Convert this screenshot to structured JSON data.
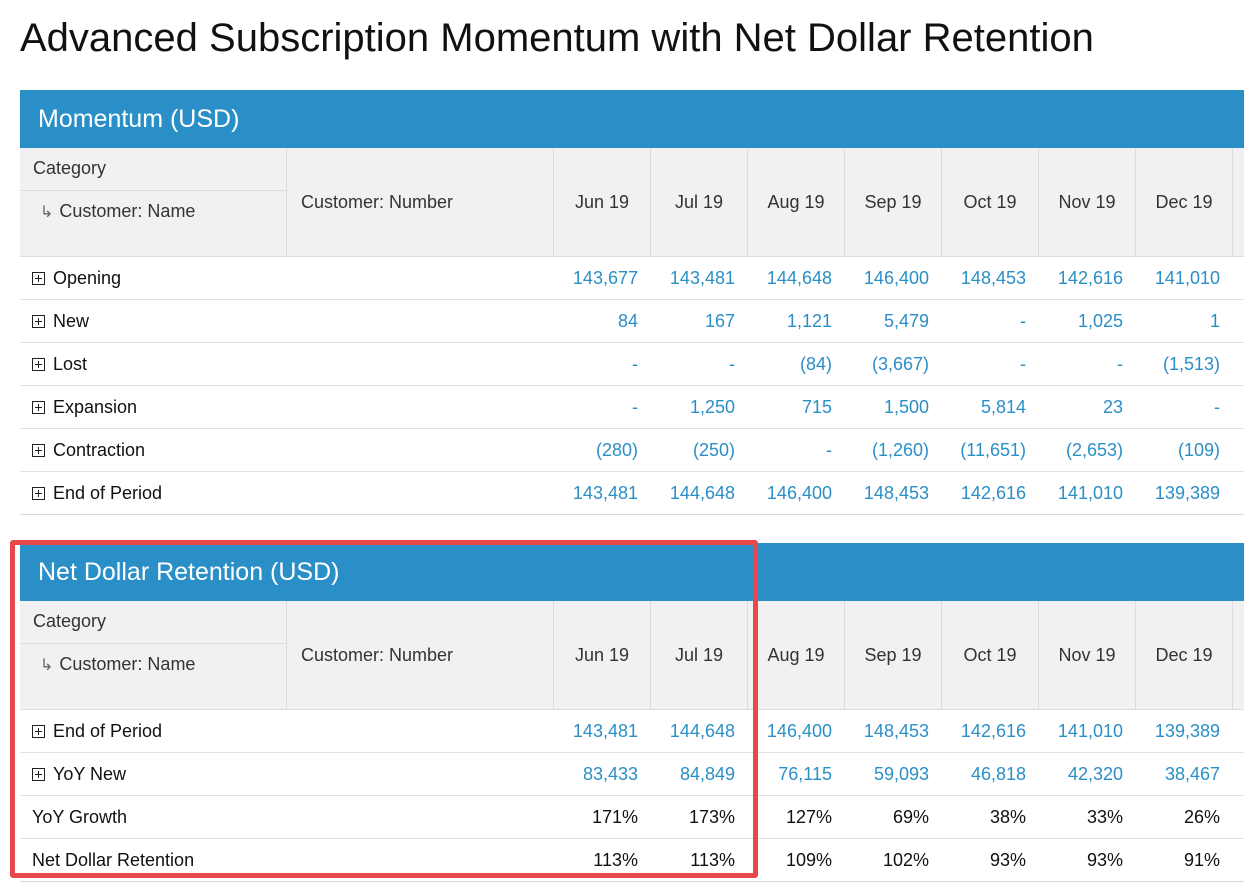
{
  "page": {
    "title": "Advanced Subscription Momentum with Net Dollar Retention"
  },
  "colors": {
    "header_blue": "#2a8fc7",
    "link_blue": "#2a8fc7",
    "highlight_red": "#e8484b"
  },
  "header_labels": {
    "category": "Category",
    "customer_name": "Customer: Name",
    "customer_number": "Customer: Number",
    "arrow_icon": "↳"
  },
  "months": [
    "Jun 19",
    "Jul 19",
    "Aug 19",
    "Sep 19",
    "Oct 19",
    "Nov 19",
    "Dec 19"
  ],
  "momentum": {
    "title": "Momentum (USD)",
    "rows": [
      {
        "label": "Opening",
        "expandable": true,
        "style": "link",
        "values": [
          "143,677",
          "143,481",
          "144,648",
          "146,400",
          "148,453",
          "142,616",
          "141,010"
        ]
      },
      {
        "label": "New",
        "expandable": true,
        "style": "link",
        "values": [
          "84",
          "167",
          "1,121",
          "5,479",
          "-",
          "1,025",
          "1"
        ]
      },
      {
        "label": "Lost",
        "expandable": true,
        "style": "link",
        "values": [
          "-",
          "-",
          "(84)",
          "(3,667)",
          "-",
          "-",
          "(1,513)"
        ]
      },
      {
        "label": "Expansion",
        "expandable": true,
        "style": "link",
        "values": [
          "-",
          "1,250",
          "715",
          "1,500",
          "5,814",
          "23",
          "-"
        ]
      },
      {
        "label": "Contraction",
        "expandable": true,
        "style": "link",
        "values": [
          "(280)",
          "(250)",
          "-",
          "(1,260)",
          "(11,651)",
          "(2,653)",
          "(109)"
        ]
      },
      {
        "label": "End of Period",
        "expandable": true,
        "style": "link",
        "values": [
          "143,481",
          "144,648",
          "146,400",
          "148,453",
          "142,616",
          "141,010",
          "139,389"
        ]
      }
    ]
  },
  "ndr": {
    "title": "Net Dollar Retention (USD)",
    "rows": [
      {
        "label": "End of Period",
        "expandable": true,
        "style": "link",
        "values": [
          "143,481",
          "144,648",
          "146,400",
          "148,453",
          "142,616",
          "141,010",
          "139,389"
        ]
      },
      {
        "label": "YoY New",
        "expandable": true,
        "style": "link",
        "values": [
          "83,433",
          "84,849",
          "76,115",
          "59,093",
          "46,818",
          "42,320",
          "38,467"
        ]
      },
      {
        "label": "YoY Growth",
        "expandable": false,
        "style": "plain",
        "values": [
          "171%",
          "173%",
          "127%",
          "69%",
          "38%",
          "33%",
          "26%"
        ]
      },
      {
        "label": "Net Dollar Retention",
        "expandable": false,
        "style": "plain",
        "values": [
          "113%",
          "113%",
          "109%",
          "102%",
          "93%",
          "93%",
          "91%"
        ]
      }
    ]
  }
}
